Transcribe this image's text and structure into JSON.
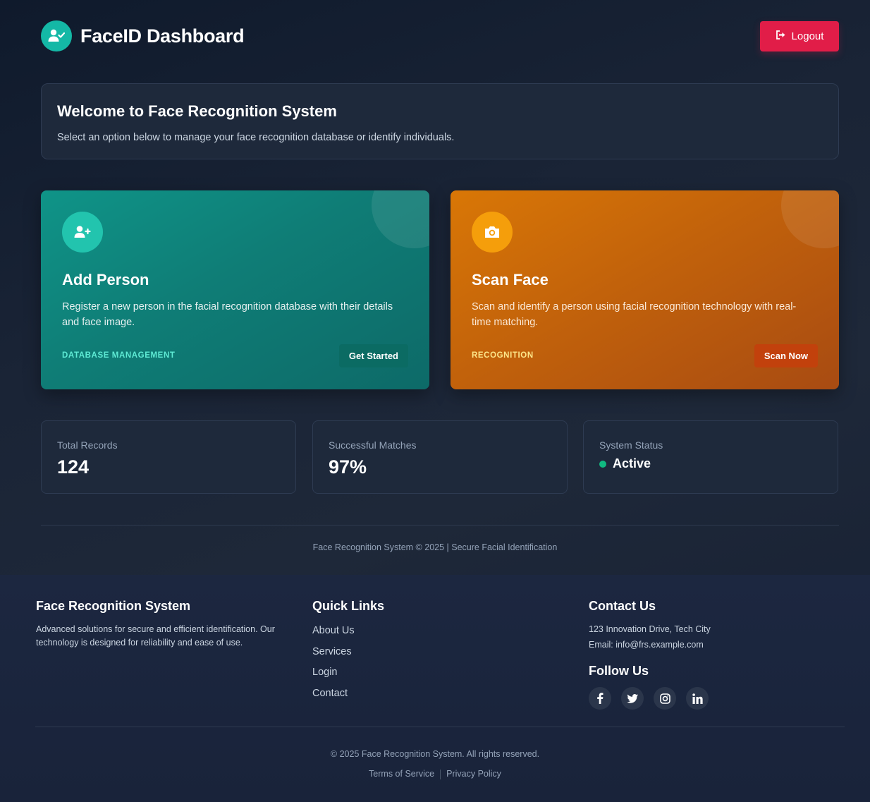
{
  "header": {
    "title": "FaceID Dashboard",
    "logout_label": "Logout",
    "logout_color": "#e11d48"
  },
  "welcome": {
    "title": "Welcome to Face Recognition System",
    "subtitle": "Select an option below to manage your face recognition database or identify individuals."
  },
  "cards": [
    {
      "icon": "user-plus-icon",
      "title": "Add Person",
      "description": "Register a new person in the facial recognition database with their details and face image.",
      "tag": "DATABASE MANAGEMENT",
      "cta": "Get Started",
      "color": "#0f9488"
    },
    {
      "icon": "camera-icon",
      "title": "Scan Face",
      "description": "Scan and identify a person using facial recognition technology with real-time matching.",
      "tag": "RECOGNITION",
      "cta": "Scan Now",
      "color": "#d97706"
    }
  ],
  "stats": [
    {
      "label": "Total Records",
      "value": "124"
    },
    {
      "label": "Successful Matches",
      "value": "97%"
    },
    {
      "label": "System Status",
      "value": "Active",
      "status_color": "#10b981"
    }
  ],
  "page_copyright": "Face Recognition System © 2025 | Secure Facial Identification",
  "footer": {
    "about": {
      "title": "Face Recognition System",
      "text": "Advanced solutions for secure and efficient identification. Our technology is designed for reliability and ease of use."
    },
    "quick_links": {
      "title": "Quick Links",
      "items": [
        "About Us",
        "Services",
        "Login",
        "Contact"
      ]
    },
    "contact": {
      "title": "Contact Us",
      "address": "123 Innovation Drive, Tech City",
      "email": "Email: info@frs.example.com",
      "follow_title": "Follow Us",
      "socials": [
        "facebook-icon",
        "twitter-icon",
        "instagram-icon",
        "linkedin-icon"
      ]
    },
    "copyright": "© 2025 Face Recognition System. All rights reserved.",
    "terms": "Terms of Service",
    "privacy": "Privacy Policy"
  }
}
